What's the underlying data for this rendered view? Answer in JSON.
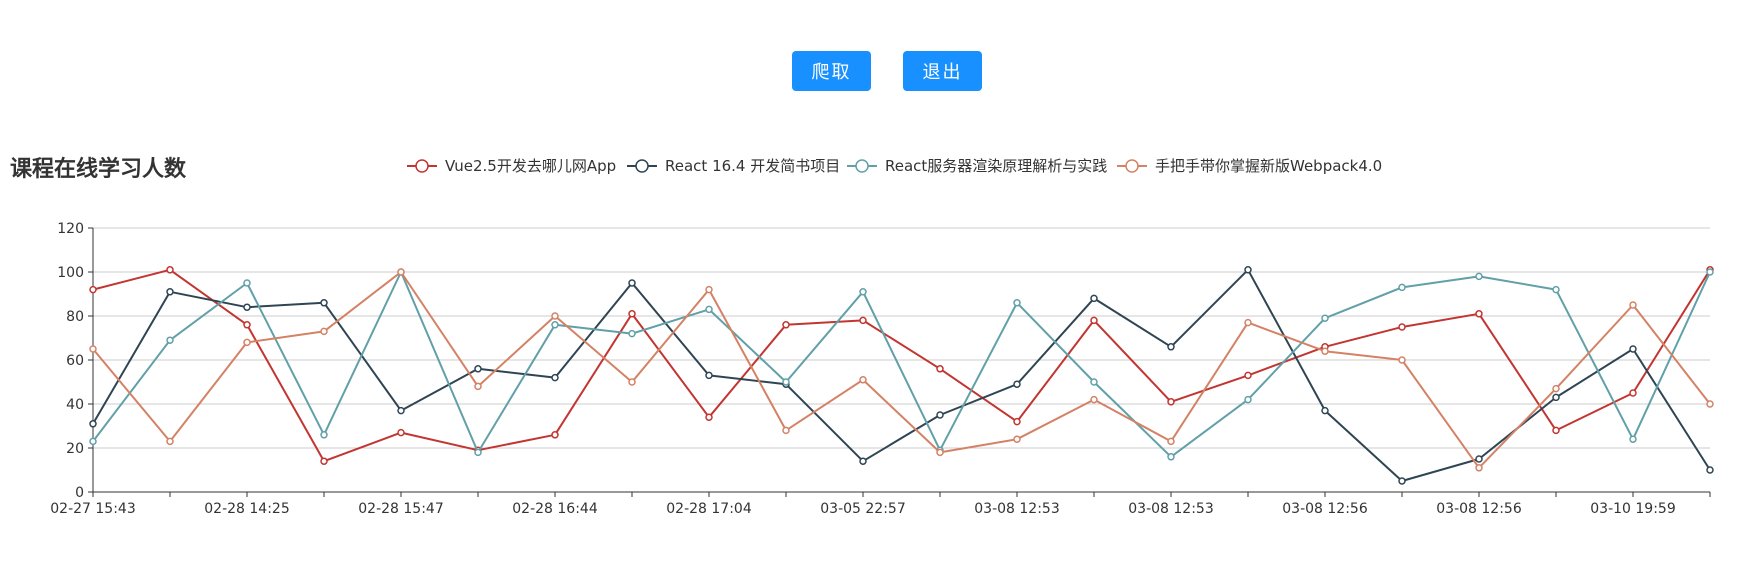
{
  "toolbar": {
    "crawl_label": "爬取",
    "exit_label": "退出",
    "button_color": "#1890ff"
  },
  "chart_data": {
    "type": "line",
    "title": "课程在线学习人数",
    "xlabel": "",
    "ylabel": "",
    "ylim": [
      0,
      120
    ],
    "yticks": [
      0,
      20,
      40,
      60,
      80,
      100,
      120
    ],
    "grid": true,
    "legend": "top-center",
    "x": [
      "02-27 15:43",
      "",
      "02-28 14:25",
      "",
      "02-28 15:47",
      "",
      "02-28 16:44",
      "",
      "02-28 17:04",
      "",
      "03-05 22:57",
      "",
      "03-08 12:53",
      "",
      "03-08 12:53",
      "",
      "03-08 12:56",
      "",
      "03-08 12:56",
      "",
      "03-10 19:59",
      ""
    ],
    "series": [
      {
        "name": "Vue2.5开发去哪儿网App",
        "color": "#c23531",
        "values": [
          92,
          101,
          76,
          14,
          27,
          19,
          26,
          81,
          34,
          76,
          78,
          56,
          32,
          78,
          41,
          53,
          66,
          75,
          81,
          28,
          45,
          101
        ]
      },
      {
        "name": "React 16.4 开发简书项目",
        "color": "#2f4554",
        "values": [
          31,
          91,
          84,
          86,
          37,
          56,
          52,
          95,
          53,
          49,
          14,
          35,
          49,
          88,
          66,
          101,
          37,
          5,
          15,
          43,
          65,
          10
        ]
      },
      {
        "name": "React服务器渲染原理解析与实践",
        "color": "#61a0a8",
        "values": [
          23,
          69,
          95,
          26,
          100,
          18,
          76,
          72,
          83,
          50,
          91,
          19,
          86,
          50,
          16,
          42,
          79,
          93,
          98,
          92,
          24,
          100
        ]
      },
      {
        "name": "手把手带你掌握新版Webpack4.0",
        "color": "#d48265",
        "values": [
          65,
          23,
          68,
          73,
          100,
          48,
          80,
          50,
          92,
          28,
          51,
          18,
          24,
          42,
          23,
          77,
          64,
          60,
          11,
          47,
          85,
          40
        ]
      }
    ]
  }
}
